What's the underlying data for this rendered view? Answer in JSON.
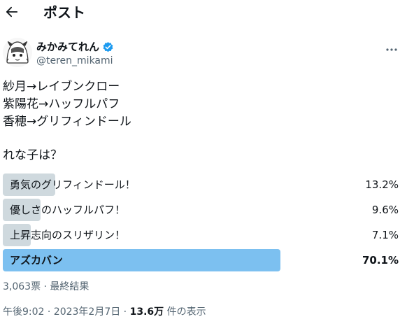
{
  "header": {
    "title": "ポスト",
    "back_icon": "back-arrow-icon"
  },
  "author": {
    "display_name": "みかみてれん",
    "handle": "@teren_mikami",
    "verified_color": "#1d9bf0"
  },
  "tweet": {
    "lines": [
      "紗月→レイブンクロー",
      "紫陽花→ハッフルパフ",
      "香穂→グリフィンドール"
    ],
    "question": "れな子は？"
  },
  "poll": {
    "options": [
      {
        "label": "勇気のグリフィンドール！",
        "percent_text": "13.2%",
        "percent": 13.2
      },
      {
        "label": "優しさのハッフルパフ！",
        "percent_text": "9.6%",
        "percent": 9.6
      },
      {
        "label": "上昇志向のスリザリン！",
        "percent_text": "7.1%",
        "percent": 7.1
      },
      {
        "label": "アズカバン",
        "percent_text": "70.1%",
        "percent": 70.1,
        "winner": true
      }
    ],
    "summary": "3,063票 · 最終結果",
    "bar_color": "#cfd9de",
    "winner_color": "#7cc0f0"
  },
  "meta": {
    "time_date": "午後9:02 · 2023年2月7日 · ",
    "views_count": "13.6万",
    "views_suffix": " 件の表示"
  }
}
